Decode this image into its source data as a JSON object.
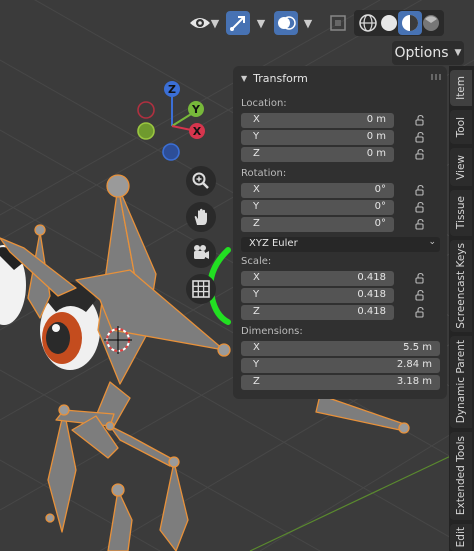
{
  "header": {
    "options_label": "Options",
    "icons": [
      "eye-icon",
      "chevron-down-icon",
      "gizmo-icon",
      "chevron-down-icon",
      "overlay-icon",
      "chevron-down-icon",
      "xray-icon",
      "wireframe-shading-icon",
      "solid-shading-icon",
      "material-shading-icon",
      "rendered-shading-icon"
    ]
  },
  "gizmo": {
    "z": "Z",
    "y": "Y",
    "x": "X"
  },
  "transform": {
    "title": "Transform",
    "location": {
      "label": "Location:",
      "rows": [
        {
          "axis": "X",
          "value": "0 m"
        },
        {
          "axis": "Y",
          "value": "0 m"
        },
        {
          "axis": "Z",
          "value": "0 m"
        }
      ]
    },
    "rotation": {
      "label": "Rotation:",
      "rows": [
        {
          "axis": "X",
          "value": "0°"
        },
        {
          "axis": "Y",
          "value": "0°"
        },
        {
          "axis": "Z",
          "value": "0°"
        }
      ],
      "mode": "XYZ Euler"
    },
    "scale": {
      "label": "Scale:",
      "rows": [
        {
          "axis": "X",
          "value": "0.418"
        },
        {
          "axis": "Y",
          "value": "0.418"
        },
        {
          "axis": "Z",
          "value": "0.418"
        }
      ]
    },
    "dimensions": {
      "label": "Dimensions:",
      "rows": [
        {
          "axis": "X",
          "value": "5.5 m"
        },
        {
          "axis": "Y",
          "value": "2.84 m"
        },
        {
          "axis": "Z",
          "value": "3.18 m"
        }
      ]
    }
  },
  "tabs": [
    "Item",
    "Tool",
    "View",
    "Tissue",
    "Screencast Keys",
    "Dynamic Parent",
    "Extended Tools",
    "Edit"
  ],
  "colors": {
    "accent": "#4772b3",
    "bone_outline": "#e8913a",
    "annotation": "#22e022"
  }
}
